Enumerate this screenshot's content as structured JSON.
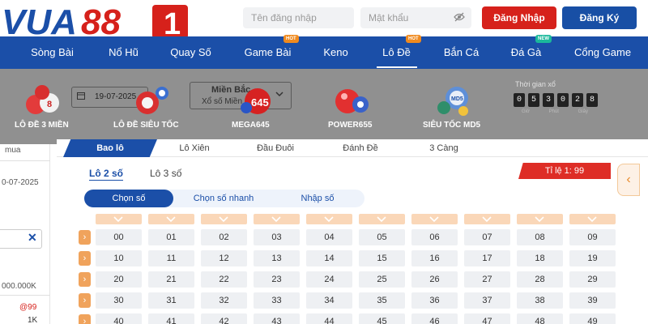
{
  "header": {
    "logo": {
      "text_left": "VUA",
      "text_right": "88",
      "digit": "1"
    },
    "username_placeholder": "Tên đăng nhập",
    "password_placeholder": "Mật khẩu",
    "login_label": "Đăng Nhập",
    "register_label": "Đăng Ký",
    "colors": {
      "primary": "#1b4fa8",
      "login": "#d6211b",
      "register": "#184fa5"
    }
  },
  "nav": {
    "items": [
      {
        "label": "Sòng Bài",
        "badge": ""
      },
      {
        "label": "Nổ Hũ",
        "badge": ""
      },
      {
        "label": "Quay Số",
        "badge": ""
      },
      {
        "label": "Game Bài",
        "badge": "HOT"
      },
      {
        "label": "Keno",
        "badge": ""
      },
      {
        "label": "Lô Đề",
        "badge": "HOT"
      },
      {
        "label": "Bắn Cá",
        "badge": ""
      },
      {
        "label": "Đá Gà",
        "badge": "NEW"
      },
      {
        "label": "Cổng Game",
        "badge": ""
      }
    ],
    "active": "Lô Đề"
  },
  "dropdown": {
    "games": [
      {
        "label": "LÔ ĐỀ 3 MIỀN",
        "icon": "lottery-balls-icon"
      },
      {
        "label": "LÔ ĐỀ SIÊU TỐC",
        "icon": "fast-lottery-icon"
      },
      {
        "label": "MEGA645",
        "icon": "mega645-icon"
      },
      {
        "label": "POWER655",
        "icon": "power655-icon"
      },
      {
        "label": "SIÊU TỐC MD5",
        "icon": "md5-icon"
      }
    ],
    "behind": {
      "date": "19-07-2025",
      "region": "Miền Bắc",
      "region_sub": "Xổ số Miền Bắc"
    },
    "timer": {
      "label": "Thời gian xổ",
      "digits": [
        "0",
        "5",
        "3",
        "0",
        "2",
        "8"
      ],
      "units": [
        "Giờ",
        "Phút",
        "Giây"
      ]
    }
  },
  "sidebar": {
    "buy": "mua",
    "date": "0-07-2025",
    "amount": "000.000K",
    "rate": "@99",
    "unit": "1K"
  },
  "bet_tabs": [
    "Bao lô",
    "Lô Xiên",
    "Đầu Đuôi",
    "Đánh Đề",
    "3 Càng"
  ],
  "sub_tabs": [
    "Lô 2 số",
    "Lô 3 số"
  ],
  "ratio": "Tỉ lệ 1: 99",
  "modes": [
    "Chọn số",
    "Chọn số nhanh",
    "Nhập số"
  ],
  "grid": {
    "rows": [
      [
        "00",
        "01",
        "02",
        "03",
        "04",
        "05",
        "06",
        "07",
        "08",
        "09"
      ],
      [
        "10",
        "11",
        "12",
        "13",
        "14",
        "15",
        "16",
        "17",
        "18",
        "19"
      ],
      [
        "20",
        "21",
        "22",
        "23",
        "24",
        "25",
        "26",
        "27",
        "28",
        "29"
      ],
      [
        "30",
        "31",
        "32",
        "33",
        "34",
        "35",
        "36",
        "37",
        "38",
        "39"
      ],
      [
        "40",
        "41",
        "42",
        "43",
        "44",
        "45",
        "46",
        "47",
        "48",
        "49"
      ]
    ]
  }
}
